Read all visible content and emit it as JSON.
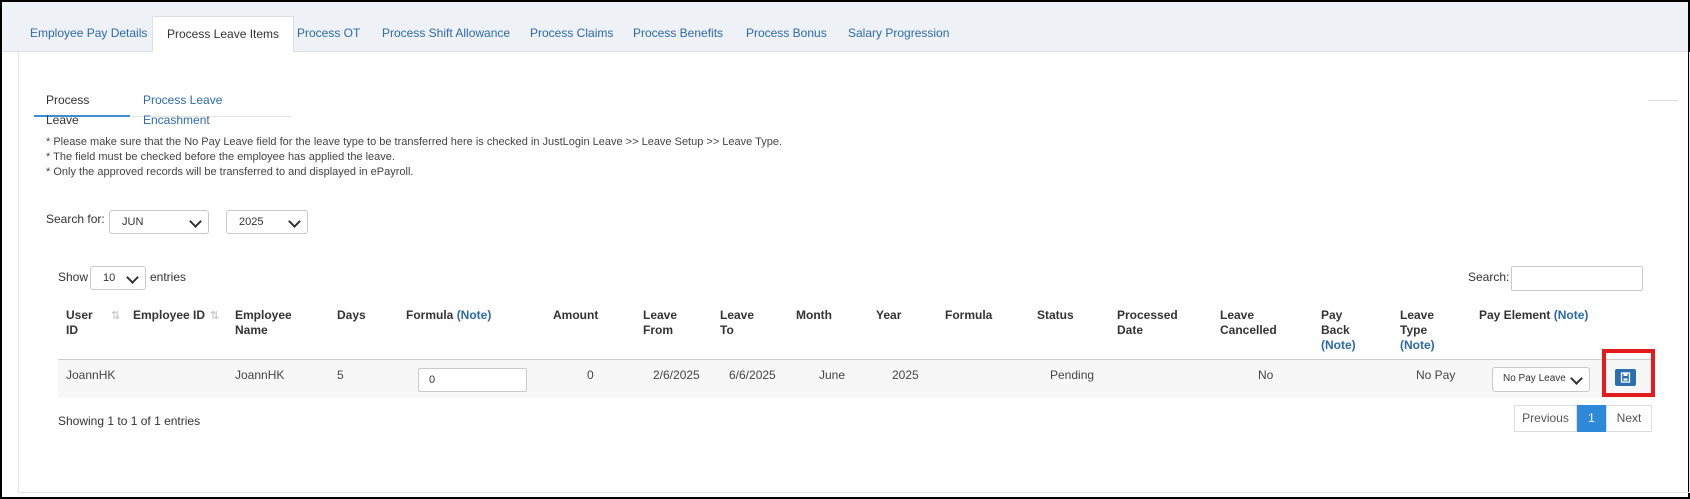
{
  "top_tabs": [
    {
      "label": "Employee Pay Details"
    },
    {
      "label": "Process Leave Items"
    },
    {
      "label": "Process OT"
    },
    {
      "label": "Process Shift Allowance"
    },
    {
      "label": "Process Claims"
    },
    {
      "label": "Process Benefits"
    },
    {
      "label": "Process Bonus"
    },
    {
      "label": "Salary Progression"
    }
  ],
  "sub_tabs": [
    {
      "label": "Process Leave"
    },
    {
      "label": "Process Leave Encashment"
    }
  ],
  "notes": [
    "* Please make sure that the No Pay Leave field for the leave type to be transferred here is checked in JustLogin Leave >> Leave Setup >> Leave Type.",
    "* The field must be checked before the employee has applied the leave.",
    "* Only the approved records will be transferred to and displayed in ePayroll."
  ],
  "search_for": {
    "label": "Search for:",
    "month": "JUN",
    "year": "2025"
  },
  "entries": {
    "show_label": "Show",
    "value": "10",
    "suffix": "entries"
  },
  "search": {
    "label": "Search:",
    "value": ""
  },
  "columns": {
    "user_id": [
      "User",
      "ID"
    ],
    "employee_id": "Employee ID",
    "employee_name": [
      "Employee",
      "Name"
    ],
    "days": "Days",
    "formula_note": [
      "Formula",
      "(Note)"
    ],
    "amount": "Amount",
    "leave_from": [
      "Leave",
      "From"
    ],
    "leave_to": [
      "Leave",
      "To"
    ],
    "month": "Month",
    "year": "Year",
    "formula": "Formula",
    "status": "Status",
    "processed_date": [
      "Processed",
      "Date"
    ],
    "leave_cancelled": [
      "Leave",
      "Cancelled"
    ],
    "pay_back": [
      "Pay",
      "Back",
      "(Note)"
    ],
    "leave_type": [
      "Leave",
      "Type",
      "(Note)"
    ],
    "pay_element": [
      "Pay Element",
      "(Note)"
    ]
  },
  "rows": [
    {
      "user_id": "JoannHK",
      "employee_id": "",
      "employee_name": "JoannHK",
      "days": "5",
      "formula_input": "0",
      "amount": "0",
      "leave_from": "2/6/2025",
      "leave_to": "6/6/2025",
      "month": "June",
      "year": "2025",
      "formula": "",
      "status": "Pending",
      "processed_date": "",
      "leave_cancelled": "No",
      "pay_back": "",
      "leave_type": "No Pay",
      "pay_element": "No Pay Leave"
    }
  ],
  "footer": {
    "info": "Showing 1 to 1 of 1 entries",
    "previous": "Previous",
    "page": "1",
    "next": "Next"
  },
  "icons": {
    "save": "floppy-disk-icon",
    "sort": "sort-icon"
  },
  "colors": {
    "link": "#2c6aa8",
    "active_page": "#2e8ad8",
    "save_button": "#2c6fae",
    "highlight": "#e21c1c"
  }
}
